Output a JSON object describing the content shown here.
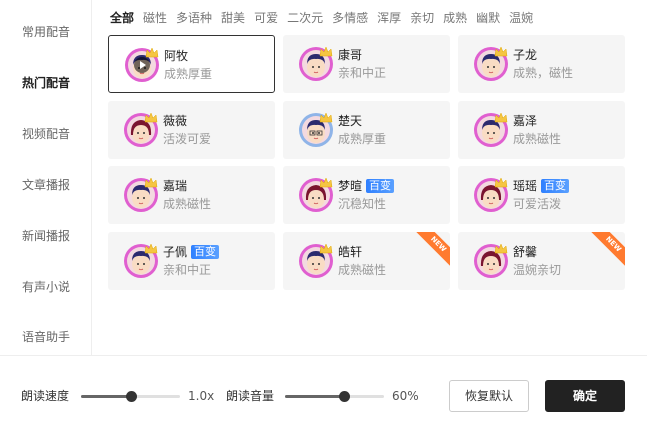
{
  "sidebar": {
    "items": [
      {
        "label": "常用配音",
        "active": false
      },
      {
        "label": "热门配音",
        "active": true
      },
      {
        "label": "视频配音",
        "active": false
      },
      {
        "label": "文章播报",
        "active": false
      },
      {
        "label": "新闻播报",
        "active": false
      },
      {
        "label": "有声小说",
        "active": false
      },
      {
        "label": "语音助手",
        "active": false
      }
    ]
  },
  "tabs": [
    "全部",
    "磁性",
    "多语种",
    "甜美",
    "可爱",
    "二次元",
    "多情感",
    "浑厚",
    "亲切",
    "成熟",
    "幽默",
    "温婉"
  ],
  "active_tab": "全部",
  "voices": [
    {
      "name": "阿牧",
      "desc": "成熟厚重",
      "gender": "male",
      "selected": true,
      "badge": "",
      "new": false,
      "glasses": false
    },
    {
      "name": "康哥",
      "desc": "亲和中正",
      "gender": "male",
      "selected": false,
      "badge": "",
      "new": false,
      "glasses": false
    },
    {
      "name": "子龙",
      "desc": "成熟，磁性",
      "gender": "male",
      "selected": false,
      "badge": "",
      "new": false,
      "glasses": false
    },
    {
      "name": "薇薇",
      "desc": "活泼可爱",
      "gender": "female",
      "selected": false,
      "badge": "",
      "new": false,
      "glasses": false
    },
    {
      "name": "楚天",
      "desc": "成熟厚重",
      "gender": "male",
      "selected": false,
      "badge": "",
      "new": false,
      "glasses": true
    },
    {
      "name": "嘉泽",
      "desc": "成熟磁性",
      "gender": "male",
      "selected": false,
      "badge": "",
      "new": false,
      "glasses": false
    },
    {
      "name": "嘉瑞",
      "desc": "成熟磁性",
      "gender": "male",
      "selected": false,
      "badge": "",
      "new": false,
      "glasses": false
    },
    {
      "name": "梦暄",
      "desc": "沉稳知性",
      "gender": "female",
      "selected": false,
      "badge": "百变",
      "new": false,
      "glasses": false
    },
    {
      "name": "瑶瑶",
      "desc": "可爱活泼",
      "gender": "female",
      "selected": false,
      "badge": "百变",
      "new": false,
      "glasses": false
    },
    {
      "name": "子佩",
      "desc": "亲和中正",
      "gender": "male",
      "selected": false,
      "badge": "百变",
      "new": false,
      "glasses": false
    },
    {
      "name": "皓轩",
      "desc": "成熟磁性",
      "gender": "male",
      "selected": false,
      "badge": "",
      "new": true,
      "glasses": false
    },
    {
      "name": "舒馨",
      "desc": "温婉亲切",
      "gender": "female",
      "selected": false,
      "badge": "",
      "new": true,
      "glasses": false
    }
  ],
  "new_ribbon_text": "NEW",
  "controls": {
    "speed": {
      "label": "朗读速度",
      "value": "1.0x",
      "fraction": 0.5
    },
    "volume": {
      "label": "朗读音量",
      "value": "60%",
      "fraction": 0.6
    }
  },
  "buttons": {
    "reset": "恢复默认",
    "ok": "确定"
  },
  "colors": {
    "accent": "#222222",
    "badge": "#2f80ff",
    "new_ribbon": "#ff7a2f",
    "avatar_ring": "#e05fd0"
  }
}
